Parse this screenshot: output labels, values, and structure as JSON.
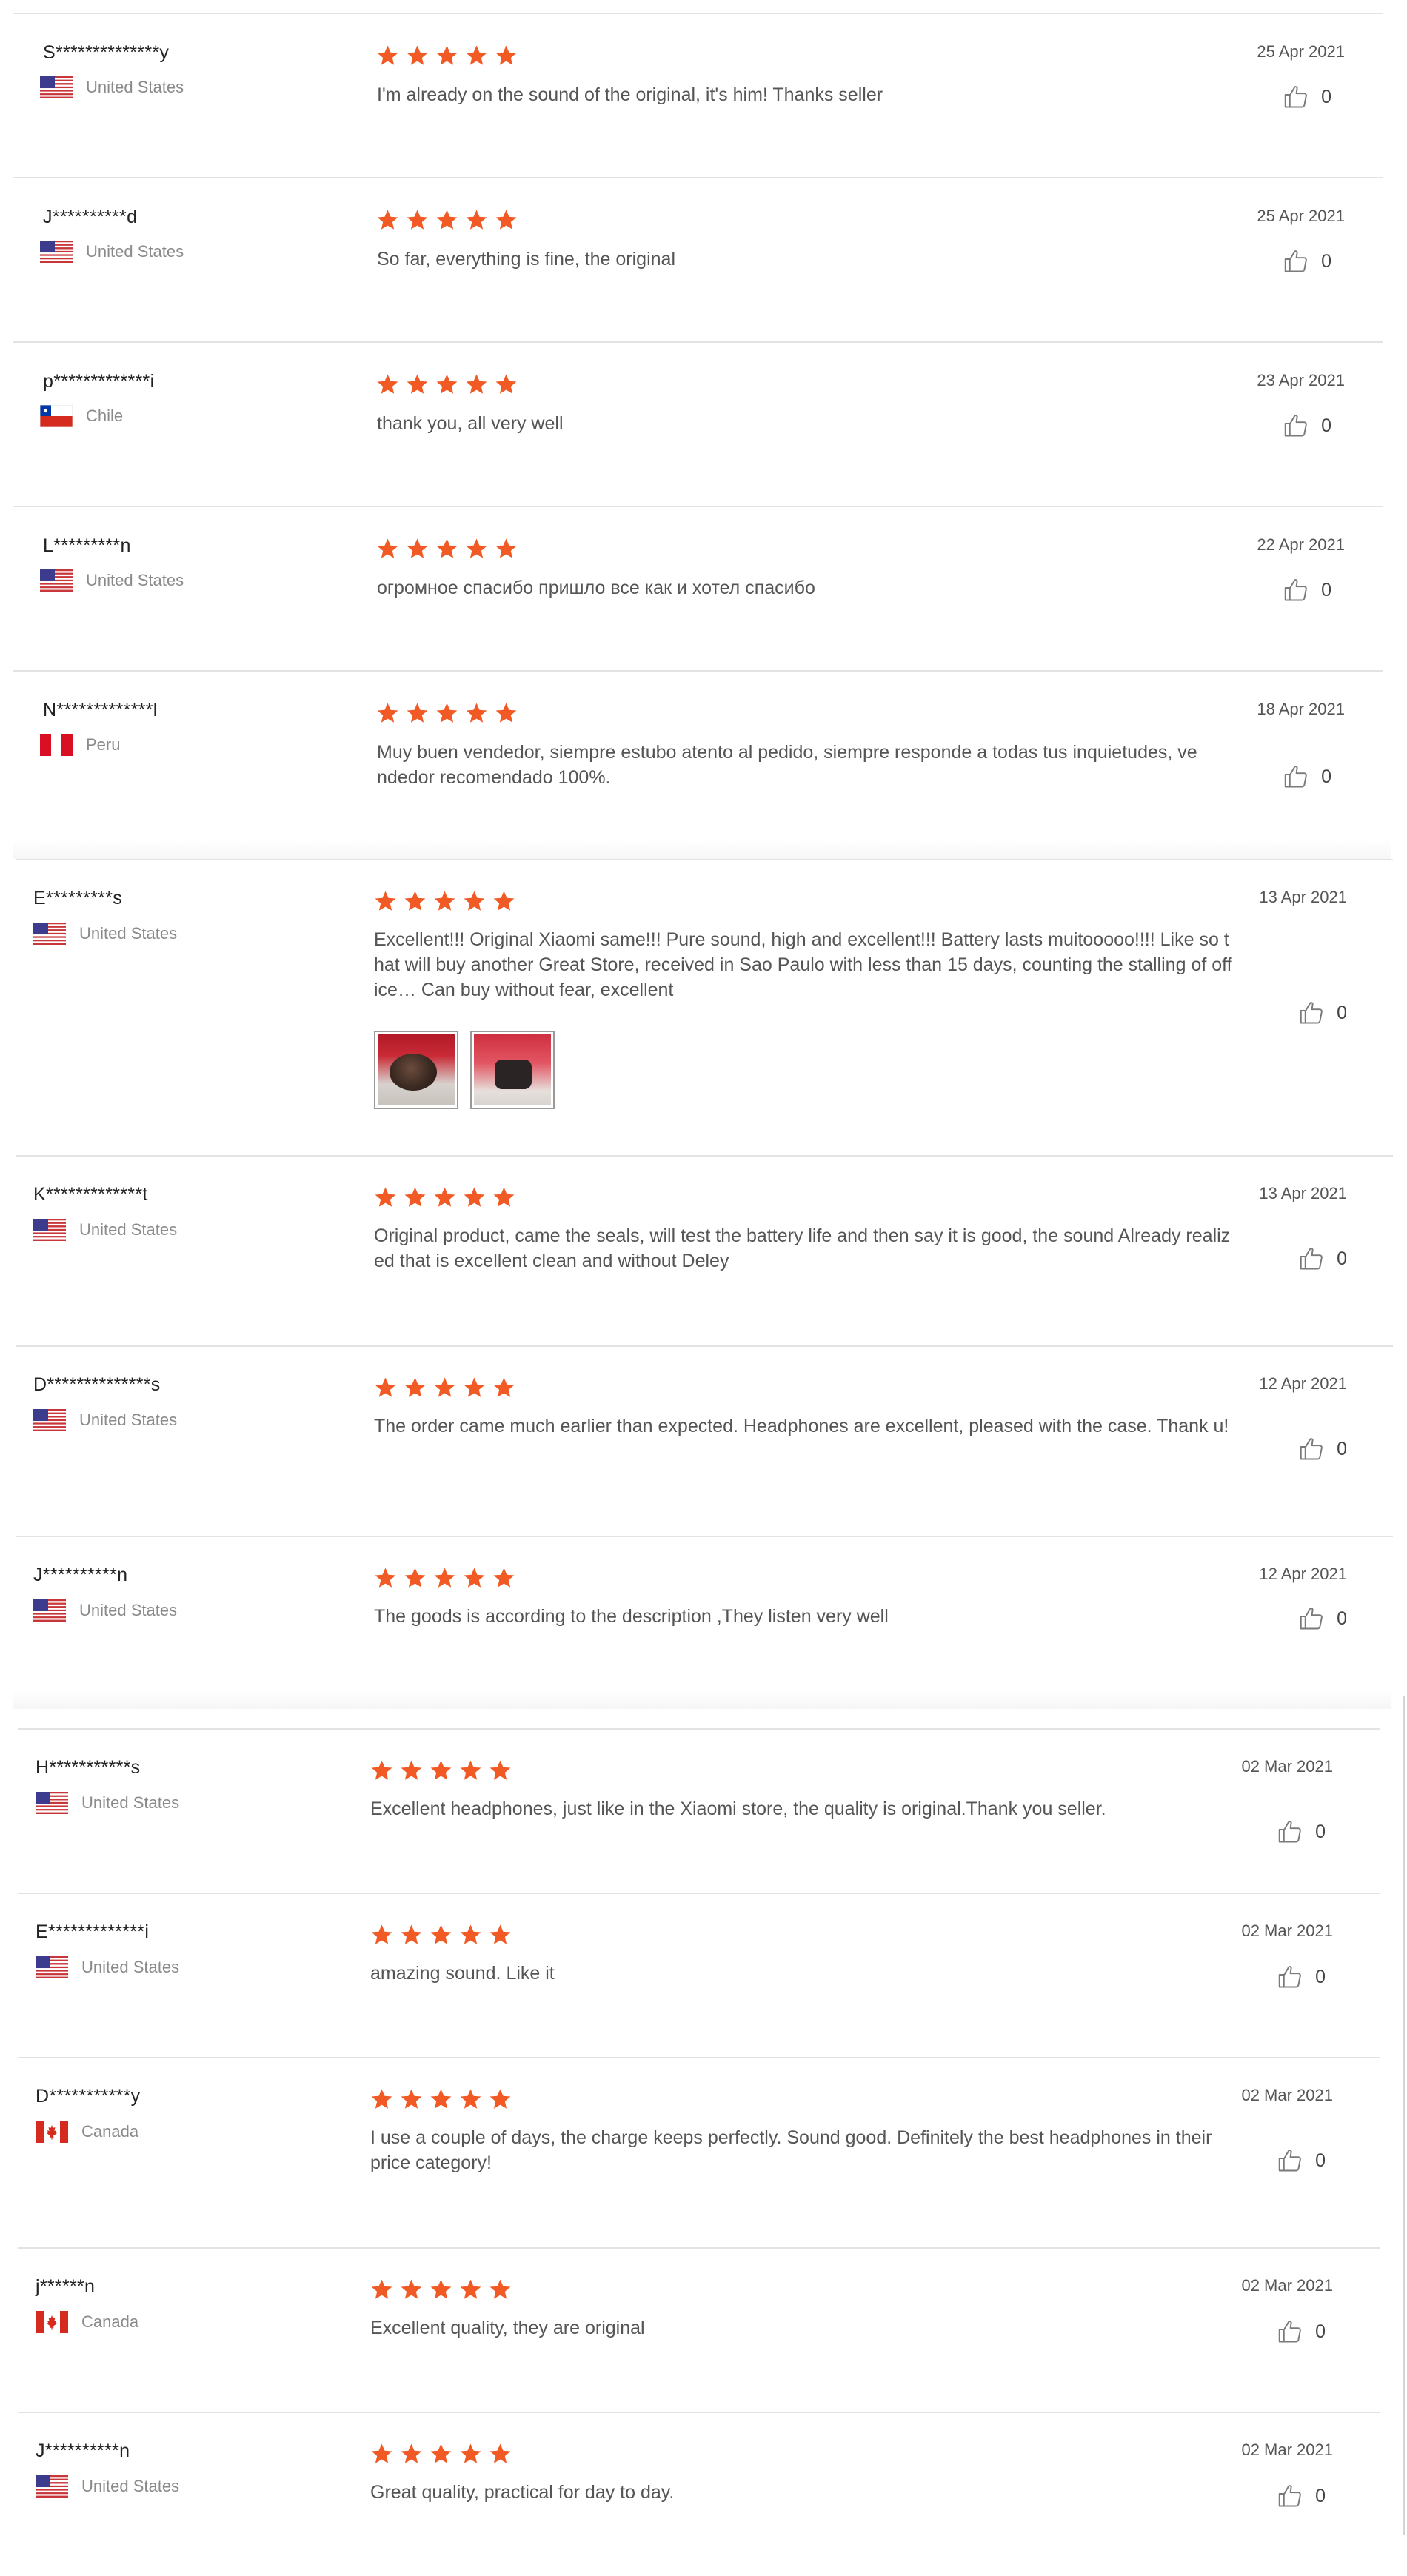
{
  "colors": {
    "star": "#f15a24",
    "divider": "#e3e3e3",
    "name_text": "#222222",
    "meta_text": "#8a8a8a",
    "body_text": "#555555"
  },
  "icons": {
    "rating": "star-icon",
    "helpful": "thumbs-up-outline-icon",
    "flags": [
      "us-flag-icon",
      "chile-flag-icon",
      "peru-flag-icon",
      "canada-flag-icon"
    ]
  },
  "groups": [
    {
      "reviews": [
        {
          "name": "S**************y",
          "country": "United States",
          "flag": "us",
          "stars": 5,
          "date": "25 Apr 2021",
          "text": "I'm already on the sound of the original, it's him! Thanks seller",
          "helpful": "0"
        },
        {
          "name": "J**********d",
          "country": "United States",
          "flag": "us",
          "stars": 5,
          "date": "25 Apr 2021",
          "text": "So far, everything is fine, the original",
          "helpful": "0"
        },
        {
          "name": "p*************i",
          "country": "Chile",
          "flag": "cl",
          "stars": 5,
          "date": "23 Apr 2021",
          "text": "thank you, all very well",
          "helpful": "0"
        },
        {
          "name": "L*********n",
          "country": "United States",
          "flag": "us",
          "stars": 5,
          "date": "22 Apr 2021",
          "text": "огромное спасибо пришло все как и хотел спасибо",
          "helpful": "0"
        },
        {
          "name": "N*************l",
          "country": "Peru",
          "flag": "pe",
          "stars": 5,
          "date": "18 Apr 2021",
          "text": "Muy buen vendedor, siempre estubo atento al pedido, siempre responde a todas tus inquietudes, vendedor recomendado 100%.",
          "helpful": "0"
        }
      ]
    },
    {
      "reviews": [
        {
          "name": "E*********s",
          "country": "United States",
          "flag": "us",
          "stars": 5,
          "date": "13 Apr 2021",
          "text": "Excellent!!! Original Xiaomi same!!! Pure sound, high and excellent!!! Battery lasts muitooooo!!!! Like so that will buy another Great Store, received in Sao Paulo with less than 15 days, counting the stalling of office… Can buy without fear, excellent",
          "helpful": "0",
          "photos": [
            "review-photo-1",
            "review-photo-2"
          ]
        },
        {
          "name": "K*************t",
          "country": "United States",
          "flag": "us",
          "stars": 5,
          "date": "13 Apr 2021",
          "text": "Original product, came the seals, will test the battery life and then say it is good, the sound Already realized that is excellent clean and without Deley",
          "helpful": "0"
        },
        {
          "name": "D**************s",
          "country": "United States",
          "flag": "us",
          "stars": 5,
          "date": "12 Apr 2021",
          "text": "The order came much earlier than expected. Headphones are excellent, pleased with the case. Thank u!",
          "helpful": "0"
        },
        {
          "name": "J**********n",
          "country": "United States",
          "flag": "us",
          "stars": 5,
          "date": "12 Apr 2021",
          "text": "The goods is according to the description ,They listen very well",
          "helpful": "0"
        }
      ]
    },
    {
      "reviews": [
        {
          "name": "H***********s",
          "country": "United States",
          "flag": "us",
          "stars": 5,
          "date": "02 Mar 2021",
          "text": "Excellent headphones, just like in the Xiaomi store, the quality is original.Thank you seller.",
          "helpful": "0"
        },
        {
          "name": "E*************i",
          "country": "United States",
          "flag": "us",
          "stars": 5,
          "date": "02 Mar 2021",
          "text": "amazing sound. Like it",
          "helpful": "0"
        },
        {
          "name": "D***********y",
          "country": "Canada",
          "flag": "ca",
          "stars": 5,
          "date": "02 Mar 2021",
          "text": "I use a couple of days, the charge keeps perfectly. Sound good. Definitely the best headphones in their price category!",
          "helpful": "0"
        },
        {
          "name": "j******n",
          "country": "Canada",
          "flag": "ca",
          "stars": 5,
          "date": "02 Mar 2021",
          "text": "Excellent quality, they are original",
          "helpful": "0"
        },
        {
          "name": "J**********n",
          "country": "United States",
          "flag": "us",
          "stars": 5,
          "date": "02 Mar 2021",
          "text": "Great quality, practical for day to day.",
          "helpful": "0"
        }
      ]
    }
  ]
}
